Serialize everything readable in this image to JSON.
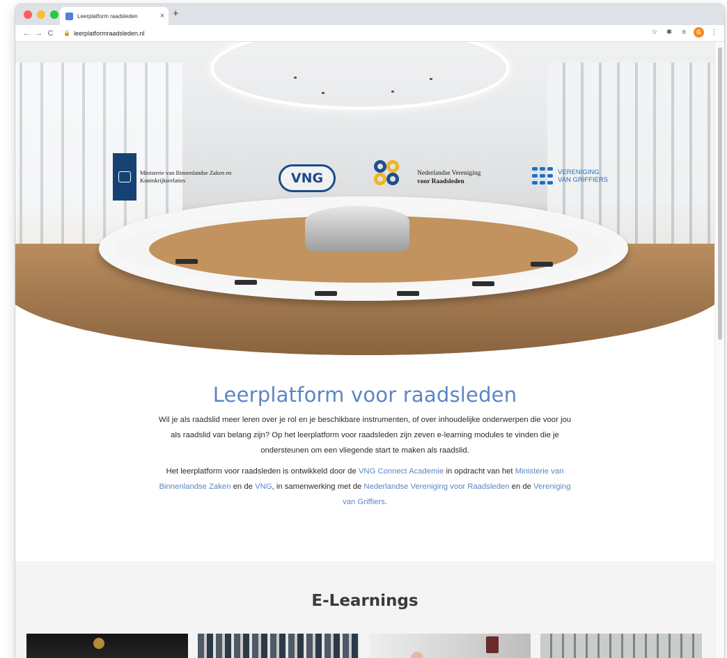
{
  "browser": {
    "tab_title": "Leerplatform raadsleden",
    "tab_close": "×",
    "new_tab": "+",
    "url": "leerplatformraadsleden.nl",
    "avatar_letter": "G",
    "icons": [
      "back-arrow-icon",
      "forward-arrow-icon",
      "reload-icon",
      "lock-icon",
      "star-icon",
      "puzzle-extension-icon",
      "reading-list-icon",
      "kebab-menu-icon"
    ]
  },
  "hero": {
    "logos": {
      "rijk_text": "Ministerie van Binnenlandse Zaken en Koninkrijksrelaties",
      "vng_text": "VNG",
      "nvvr_text_line1": "Nederlandse Vereniging",
      "nvvr_text_line2": "voor Raadsleden",
      "vvg_text_line1": "VERENIGING",
      "vvg_text_line2": "VAN GRIFFIERS"
    }
  },
  "intro": {
    "title": "Leerplatform voor raadsleden",
    "paragraph1": "Wil je als raadslid meer leren over je rol en je beschikbare instrumenten, of over inhoudelijke onderwerpen die voor jou als raadslid van belang zijn? Op het leerplatform voor raadsleden zijn zeven e-learning modules te vinden die je ondersteunen om een vliegende start te maken als raadslid.",
    "p2_part1": "Het leerplatform voor raadsleden is ontwikkeld door de ",
    "p2_link1": "VNG Connect Academie",
    "p2_part2": " in opdracht van het ",
    "p2_link2": "Ministerie van Binnenlandse Zaken",
    "p2_part3": " en de ",
    "p2_link3": "VNG",
    "p2_part4": ", in samenwerking met de ",
    "p2_link4": "Nederlandse Vereniging voor Raadsleden",
    "p2_part5": " en de ",
    "p2_link5": "Vereniging van Griffiers",
    "p2_part6": "."
  },
  "elearnings": {
    "title": "E-Learnings"
  },
  "colors": {
    "link": "#5a86c5",
    "rijk_blue": "#154273",
    "vng_blue": "#1c4a8c",
    "nvvr_yellow": "#f2b51e",
    "vvg_blue": "#1f6fc5"
  }
}
